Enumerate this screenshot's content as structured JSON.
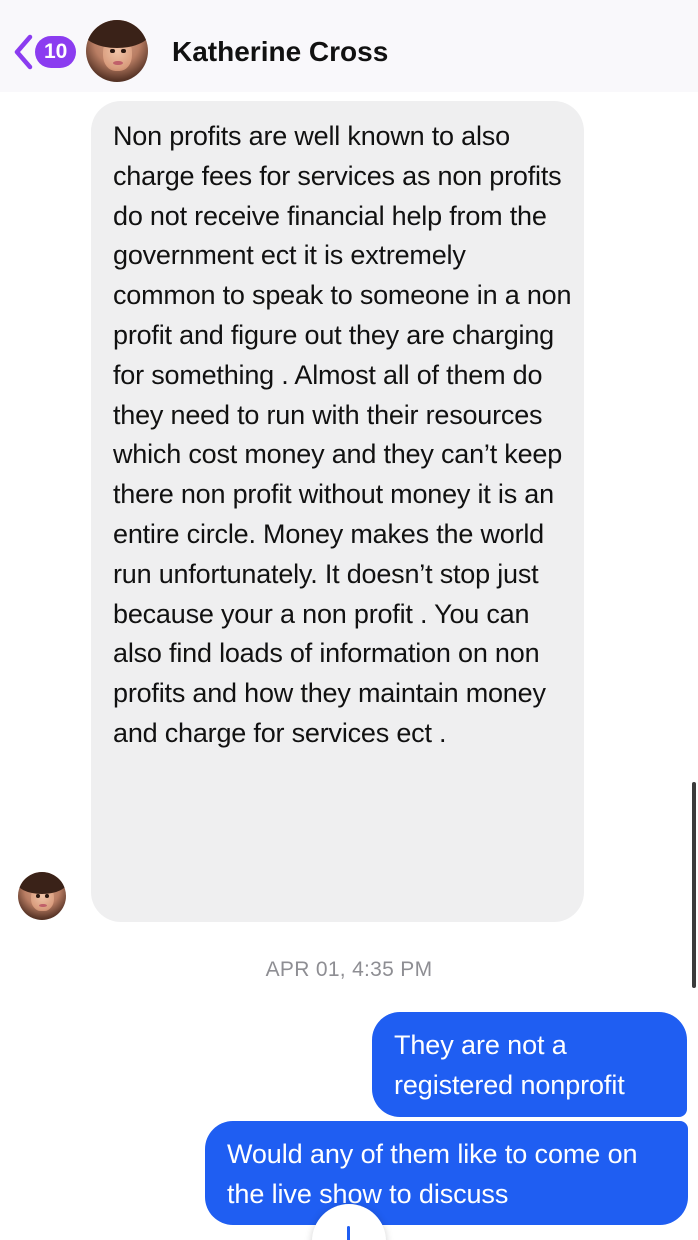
{
  "header": {
    "back_badge": "10",
    "contact_name": "Katherine Cross"
  },
  "conversation": {
    "incoming_message": "Non profits are well known to also charge fees for services as non profits do not receive financial help from the government ect it is extremely common to speak to someone in a non profit and figure out they are charging for something . Almost all of them do they need to run with their resources which cost money and they can’t keep there non profit without money it is an entire circle. Money makes the world run unfortunately. It doesn’t stop just because your a non profit . You can also find loads of information on non profits and how they maintain money and charge for services ect .",
    "timestamp": "APR 01, 4:35 PM",
    "outgoing_messages": [
      "They are not a registered nonprofit",
      "Would any of them like to come on the live show to discuss"
    ]
  },
  "colors": {
    "accent_purple": "#8b3cf0",
    "outgoing_bubble": "#1f5ef2",
    "incoming_bubble": "#efeff0",
    "timestamp": "#8e8e93"
  },
  "icons": {
    "back": "chevron-left-icon",
    "scroll_down": "arrow-down-icon"
  }
}
